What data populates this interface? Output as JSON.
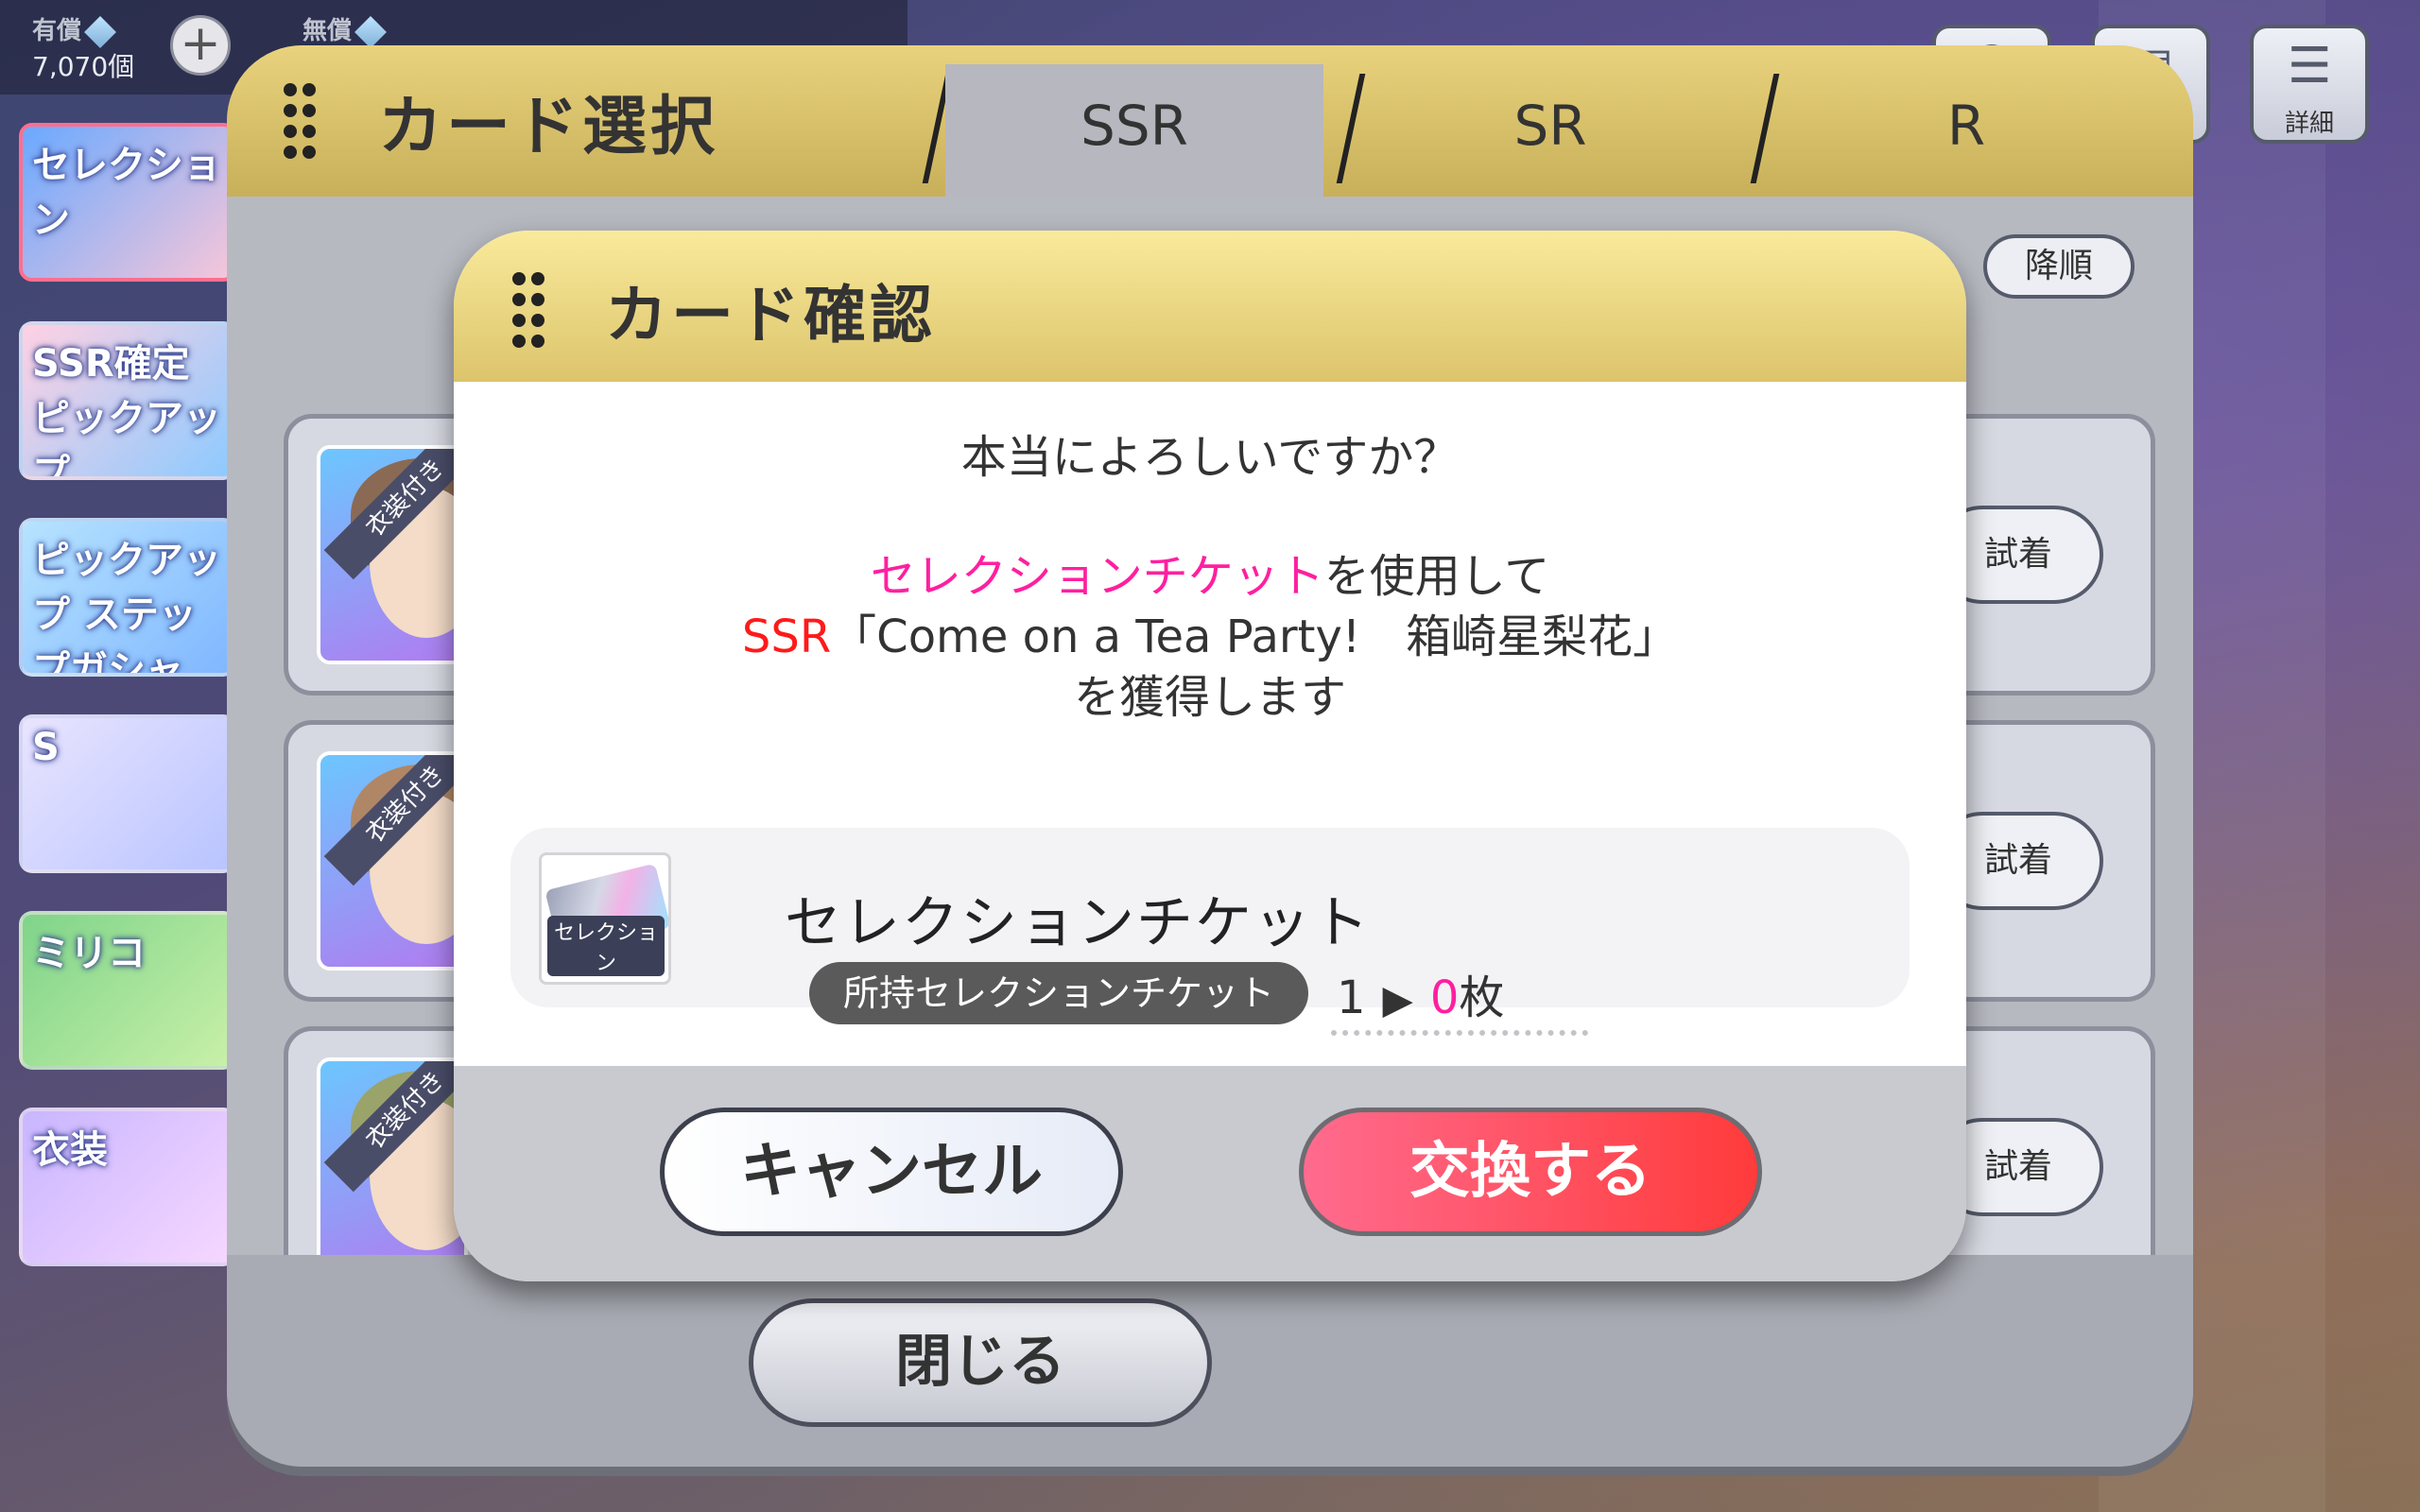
{
  "currency": {
    "paid_label": "有償",
    "paid_amount": "7,070個",
    "free_label": "無償"
  },
  "top_icons": {
    "detail_label": "詳細"
  },
  "banners": [
    {
      "label": "セレクション"
    },
    {
      "label": "SSR確定 ピックアップ"
    },
    {
      "label": "ピックアップ ステップガシャ"
    },
    {
      "label": "S"
    },
    {
      "label": "ミリコ"
    },
    {
      "label": "衣装"
    }
  ],
  "card_select": {
    "title": "カード選択",
    "tabs": [
      {
        "label": "SSR"
      },
      {
        "label": "SR"
      },
      {
        "label": "R"
      }
    ],
    "sort_label": "降順",
    "rows": [
      {
        "ribbon": "衣装付き",
        "tryon": "試着"
      },
      {
        "ribbon": "衣装付き",
        "tryon": "試着"
      },
      {
        "ribbon": "衣装付き",
        "tryon": "試着"
      }
    ],
    "close_label": "閉じる"
  },
  "dialog": {
    "title": "カード確認",
    "question": "本当によろしいですか？",
    "line1_highlight": "セレクションチケット",
    "line1_rest": "を使用して",
    "line2_rarity": "SSR",
    "line2_card": "「Come on a Tea Party!　箱崎星梨花」",
    "line3": "を獲得します",
    "item_name": "セレクションチケット",
    "item_icon_label": "セレクション",
    "owned_label": "所持セレクションチケット",
    "owned_before": "1",
    "owned_arrow": "▶",
    "owned_after": "0",
    "owned_unit": "枚",
    "cancel_label": "キャンセル",
    "exchange_label": "交換する"
  }
}
